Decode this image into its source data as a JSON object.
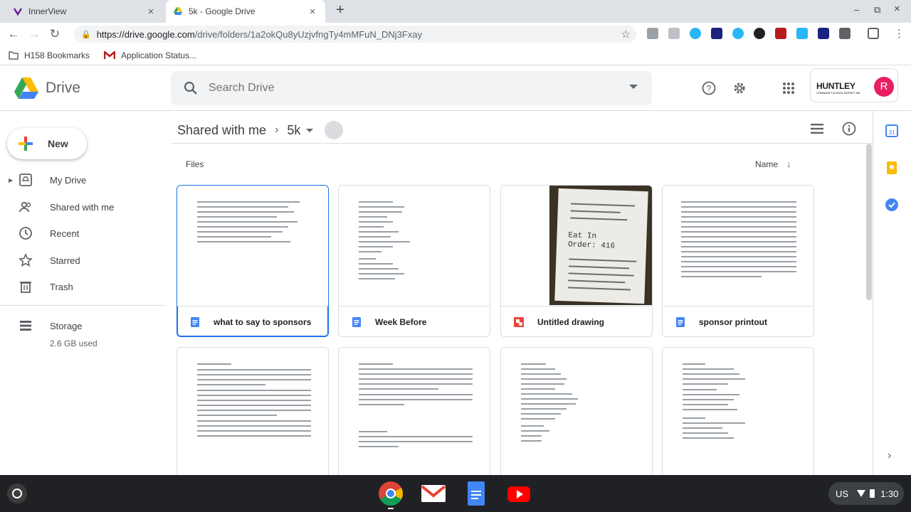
{
  "browser": {
    "tabs": [
      {
        "title": "InnerView",
        "close": "×"
      },
      {
        "title": "5k - Google Drive",
        "close": "×"
      }
    ],
    "new_tab": "+",
    "window_controls": {
      "min": "–",
      "max": "⧉",
      "close": "×"
    },
    "url_host": "https://drive.google.com",
    "url_path": "/drive/folders/1a2okQu8yUzjvfngTy4mMFuN_DNj3Fxay",
    "bookmarks": [
      {
        "label": "H158 Bookmarks"
      },
      {
        "label": "Application Status..."
      }
    ]
  },
  "drive": {
    "app_name": "Drive",
    "search_placeholder": "Search Drive",
    "org_name": "HUNTLEY",
    "org_sub": "COMMUNITY SCHOOL DISTRICT 158",
    "avatar_letter": "R",
    "new_button": "New",
    "nav": [
      {
        "label": "My Drive"
      },
      {
        "label": "Shared with me"
      },
      {
        "label": "Recent"
      },
      {
        "label": "Starred"
      },
      {
        "label": "Trash"
      }
    ],
    "storage_label": "Storage",
    "storage_used": "2.6 GB used",
    "breadcrumb": {
      "root": "Shared with me",
      "current": "5k"
    },
    "section_label": "Files",
    "sort_label": "Name",
    "files": [
      {
        "name": "what to say to sponsors",
        "type": "doc"
      },
      {
        "name": "Week Before",
        "type": "doc"
      },
      {
        "name": "Untitled drawing",
        "type": "drawing"
      },
      {
        "name": "sponsor printout",
        "type": "doc"
      }
    ],
    "receipt_text": {
      "line1": "Eat In",
      "line2": "Order:  416"
    }
  },
  "taskbar": {
    "locale": "US",
    "time": "1:30"
  },
  "colors": {
    "accent": "#1a73e8",
    "doc_icon": "#4285f4",
    "drawing_icon": "#ea4335",
    "avatar": "#e91e63"
  }
}
